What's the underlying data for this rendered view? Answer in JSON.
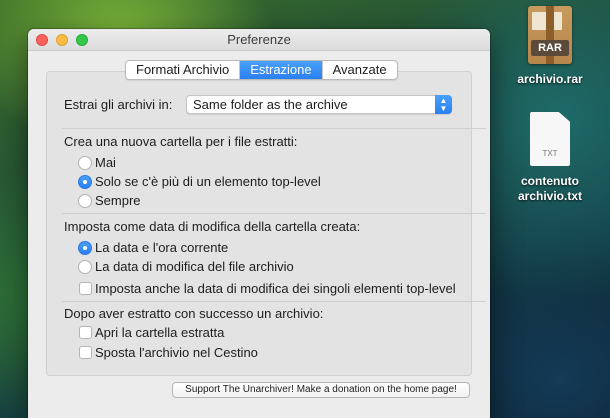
{
  "desktop": {
    "items": [
      {
        "label": "archivio.rar",
        "badge": "RAR",
        "icon": "rar-archive-icon"
      },
      {
        "label": "contenuto\narchivio.txt",
        "badge": "TXT",
        "icon": "text-file-icon"
      }
    ]
  },
  "window": {
    "title": "Preferenze",
    "tabs": [
      {
        "label": "Formati Archivio",
        "active": false
      },
      {
        "label": "Estrazione",
        "active": true
      },
      {
        "label": "Avanzate",
        "active": false
      }
    ],
    "extract_label": "Estrai gli archivi in:",
    "extract_value": "Same folder as the archive",
    "folder_section": {
      "heading": "Crea una nuova cartella per i file estratti:",
      "options": [
        {
          "label": "Mai",
          "selected": false
        },
        {
          "label": "Solo se c'è più di un elemento top-level",
          "selected": true
        },
        {
          "label": "Sempre",
          "selected": false
        }
      ]
    },
    "date_section": {
      "heading": "Imposta come data di modifica della cartella creata:",
      "options": [
        {
          "label": "La data e l'ora corrente",
          "selected": true
        },
        {
          "label": "La data di modifica del file archivio",
          "selected": false
        }
      ],
      "checkbox": {
        "label": "Imposta anche la data di modifica dei singoli elementi top-level",
        "checked": false
      }
    },
    "after_section": {
      "heading": "Dopo aver estratto con successo un archivio:",
      "checkboxes": [
        {
          "label": "Apri la cartella estratta",
          "checked": false
        },
        {
          "label": "Sposta l'archivio nel Cestino",
          "checked": false
        }
      ]
    },
    "support_button": "Support The Unarchiver! Make a donation on the home page!"
  },
  "colors": {
    "accent": "#2a7ff0",
    "window_bg": "#ececec"
  }
}
